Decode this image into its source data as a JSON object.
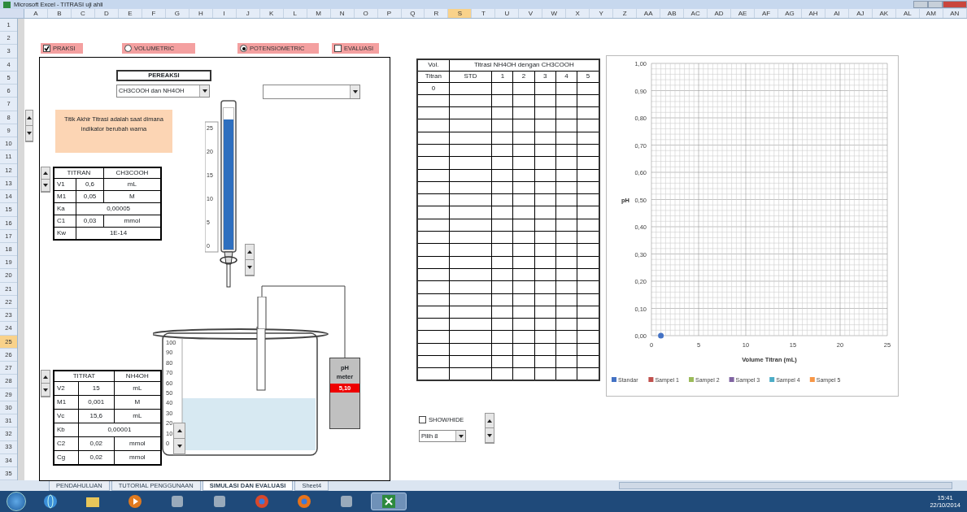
{
  "window": {
    "title": "Microsoft Excel - TITRASI uji ahli"
  },
  "column_headers": [
    {
      "label": "A",
      "selected": false
    },
    {
      "label": "B",
      "selected": false
    },
    {
      "label": "C",
      "selected": false
    },
    {
      "label": "D",
      "selected": false
    },
    {
      "label": "E",
      "selected": false
    },
    {
      "label": "F",
      "selected": false
    },
    {
      "label": "G",
      "selected": false
    },
    {
      "label": "H",
      "selected": false
    },
    {
      "label": "I",
      "selected": false
    },
    {
      "label": "J",
      "selected": false
    },
    {
      "label": "K",
      "selected": false
    },
    {
      "label": "L",
      "selected": false
    },
    {
      "label": "M",
      "selected": false
    },
    {
      "label": "N",
      "selected": false
    },
    {
      "label": "O",
      "selected": false
    },
    {
      "label": "P",
      "selected": false
    },
    {
      "label": "Q",
      "selected": false
    },
    {
      "label": "R",
      "selected": false
    },
    {
      "label": "S",
      "selected": true
    },
    {
      "label": "T",
      "selected": false
    },
    {
      "label": "U",
      "selected": false
    },
    {
      "label": "V",
      "selected": false
    },
    {
      "label": "W",
      "selected": false
    },
    {
      "label": "X",
      "selected": false
    },
    {
      "label": "Y",
      "selected": false
    },
    {
      "label": "Z",
      "selected": false
    },
    {
      "label": "AA",
      "selected": false
    },
    {
      "label": "AB",
      "selected": false
    },
    {
      "label": "AC",
      "selected": false
    },
    {
      "label": "AD",
      "selected": false
    },
    {
      "label": "AE",
      "selected": false
    },
    {
      "label": "AF",
      "selected": false
    },
    {
      "label": "AG",
      "selected": false
    },
    {
      "label": "AH",
      "selected": false
    },
    {
      "label": "AI",
      "selected": false
    },
    {
      "label": "AJ",
      "selected": false
    },
    {
      "label": "AK",
      "selected": false
    },
    {
      "label": "AL",
      "selected": false
    },
    {
      "label": "AM",
      "selected": false
    },
    {
      "label": "AN",
      "selected": false
    }
  ],
  "row_headers": [
    {
      "label": "1",
      "selected": false
    },
    {
      "label": "2",
      "selected": false
    },
    {
      "label": "3",
      "selected": false
    },
    {
      "label": "4",
      "selected": false
    },
    {
      "label": "5",
      "selected": false
    },
    {
      "label": "6",
      "selected": false
    },
    {
      "label": "7",
      "selected": false
    },
    {
      "label": "8",
      "selected": false
    },
    {
      "label": "9",
      "selected": false
    },
    {
      "label": "10",
      "selected": false
    },
    {
      "label": "11",
      "selected": false
    },
    {
      "label": "12",
      "selected": false
    },
    {
      "label": "13",
      "selected": false
    },
    {
      "label": "14",
      "selected": false
    },
    {
      "label": "15",
      "selected": false
    },
    {
      "label": "16",
      "selected": false
    },
    {
      "label": "17",
      "selected": false
    },
    {
      "label": "18",
      "selected": false
    },
    {
      "label": "19",
      "selected": false
    },
    {
      "label": "20",
      "selected": false
    },
    {
      "label": "21",
      "selected": false
    },
    {
      "label": "22",
      "selected": false
    },
    {
      "label": "23",
      "selected": false
    },
    {
      "label": "24",
      "selected": false
    },
    {
      "label": "25",
      "selected": true
    },
    {
      "label": "26",
      "selected": false
    },
    {
      "label": "27",
      "selected": false
    },
    {
      "label": "28",
      "selected": false
    },
    {
      "label": "29",
      "selected": false
    },
    {
      "label": "30",
      "selected": false
    },
    {
      "label": "31",
      "selected": false
    },
    {
      "label": "32",
      "selected": false
    },
    {
      "label": "33",
      "selected": false
    },
    {
      "label": "34",
      "selected": false
    },
    {
      "label": "35",
      "selected": false
    }
  ],
  "options": [
    {
      "kind": "checkbox",
      "label": "PRAKSI",
      "checked": true
    },
    {
      "kind": "radio",
      "label": "VOLUMETRIC",
      "selected": false
    },
    {
      "kind": "radio",
      "label": "POTENSIOMETRIC",
      "selected": true
    },
    {
      "kind": "checkbox",
      "label": "EVALUASI",
      "checked": false
    }
  ],
  "reagent": {
    "label": "PEREAKSI",
    "value": "CH3COOH dan NH4OH"
  },
  "note": "Titik Akhir Titrasi adalah saat dimana indikator berubah warna",
  "titran_table": {
    "header": [
      {
        "text": "TITRAN",
        "colspan": 2
      },
      {
        "text": "CH3COOH"
      }
    ],
    "rows": [
      [
        {
          "text": "V1"
        },
        {
          "text": "0,6"
        },
        {
          "text": "mL"
        }
      ],
      [
        {
          "text": "M1"
        },
        {
          "text": "0,05"
        },
        {
          "text": "M"
        }
      ],
      [
        {
          "text": "Ka"
        },
        {
          "text": "0,00005",
          "colspan": 2
        }
      ],
      [
        {
          "text": "C1"
        },
        {
          "text": "0,03"
        },
        {
          "text": "mmol"
        }
      ],
      [
        {
          "text": "Kw"
        },
        {
          "text": "1E-14",
          "colspan": 2
        }
      ]
    ]
  },
  "burette": {
    "level": 0.92,
    "scale": [
      "25",
      "20",
      "15",
      "10",
      "5",
      "0"
    ]
  },
  "titrat_table": {
    "header": [
      {
        "text": "TITRAT",
        "colspan": 2
      },
      {
        "text": "NH4OH"
      }
    ],
    "rows": [
      [
        {
          "text": "V2"
        },
        {
          "text": "15"
        },
        {
          "text": "mL"
        }
      ],
      [
        {
          "text": "M1"
        },
        {
          "text": "0,001"
        },
        {
          "text": "M"
        }
      ],
      [
        {
          "text": "Vc"
        },
        {
          "text": "15,6"
        },
        {
          "text": "mL"
        }
      ],
      [
        {
          "text": "Kb"
        },
        {
          "text": "0,00001",
          "colspan": 2
        }
      ],
      [
        {
          "text": "C2"
        },
        {
          "text": "0,02"
        },
        {
          "text": "mmol"
        }
      ],
      [
        {
          "text": "Cg"
        },
        {
          "text": "0,02"
        },
        {
          "text": "mmol"
        }
      ]
    ]
  },
  "beaker": {
    "scale": [
      "100",
      "90",
      "80",
      "70",
      "60",
      "50",
      "40",
      "30",
      "20",
      "10",
      "0"
    ]
  },
  "ph_meter": {
    "label_1": "pH",
    "label_2": "meter",
    "reading": "5,10"
  },
  "data_table": {
    "vol_header_1": "Vol.",
    "vol_header_2": "Titran",
    "title": "Titrasi NH4OH dengan CH3COOH",
    "columns": [
      "STD",
      "1",
      "2",
      "3",
      "4",
      "5"
    ],
    "rows": [
      [
        "0"
      ]
    ]
  },
  "show_option": {
    "label": "SHOW/HIDE",
    "checked": false
  },
  "page_select": {
    "value": "Pilih 8"
  },
  "chart": {
    "chart_data": {
      "type": "scatter",
      "grid": true,
      "xlabel": "Volume Titran (mL)",
      "ylabel": "pH",
      "x": [
        1
      ],
      "series": [
        {
          "name": "Standar",
          "color": "#4472c4",
          "values": [
            0
          ]
        },
        {
          "name": "Sampel 1",
          "color": "#c0504d",
          "values": [
            null
          ]
        },
        {
          "name": "Sampel 2",
          "color": "#9bbb59",
          "values": [
            null
          ]
        },
        {
          "name": "Sampel 3",
          "color": "#8064a2",
          "values": [
            null
          ]
        },
        {
          "name": "Sampel 4",
          "color": "#4bacc6",
          "values": [
            null
          ]
        },
        {
          "name": "Sampel 5",
          "color": "#f79646",
          "values": [
            null
          ]
        }
      ],
      "xlim": [
        0,
        25
      ],
      "ylim": [
        0,
        1
      ],
      "xticks": [
        0,
        5,
        10,
        15,
        20,
        25
      ],
      "yticks": [
        {
          "value": 0,
          "label": "0,00"
        },
        {
          "value": 0.1,
          "label": "0,10"
        },
        {
          "value": 0.2,
          "label": "0,20"
        },
        {
          "value": 0.3,
          "label": "0,30"
        },
        {
          "value": 0.4,
          "label": "0,40"
        },
        {
          "value": 0.5,
          "label": "0,50"
        },
        {
          "value": 0.6,
          "label": "0,60"
        },
        {
          "value": 0.7,
          "label": "0,70"
        },
        {
          "value": 0.8,
          "label": "0,80"
        },
        {
          "value": 0.9,
          "label": "0,90"
        },
        {
          "value": 1,
          "label": "1,00"
        }
      ]
    }
  },
  "sheet_tabs": [
    {
      "label": "PENDAHULUAN",
      "selected": false
    },
    {
      "label": "TUTORIAL PENGGUNAAN",
      "selected": false
    },
    {
      "label": "SIMULASI DAN EVALUASI",
      "selected": true
    },
    {
      "label": "Sheet4",
      "selected": false
    }
  ],
  "taskbar": {
    "apps": [
      {
        "kind": "globe",
        "active": false
      },
      {
        "kind": "folder",
        "active": false
      },
      {
        "kind": "play",
        "active": false
      },
      {
        "kind": "app",
        "active": false
      },
      {
        "kind": "app",
        "active": false
      },
      {
        "kind": "browser",
        "active": false
      },
      {
        "kind": "browser",
        "active": false
      },
      {
        "kind": "app",
        "active": false
      },
      {
        "kind": "sheet",
        "active": true
      }
    ],
    "time": "15:41",
    "date": "22/10/2014"
  }
}
